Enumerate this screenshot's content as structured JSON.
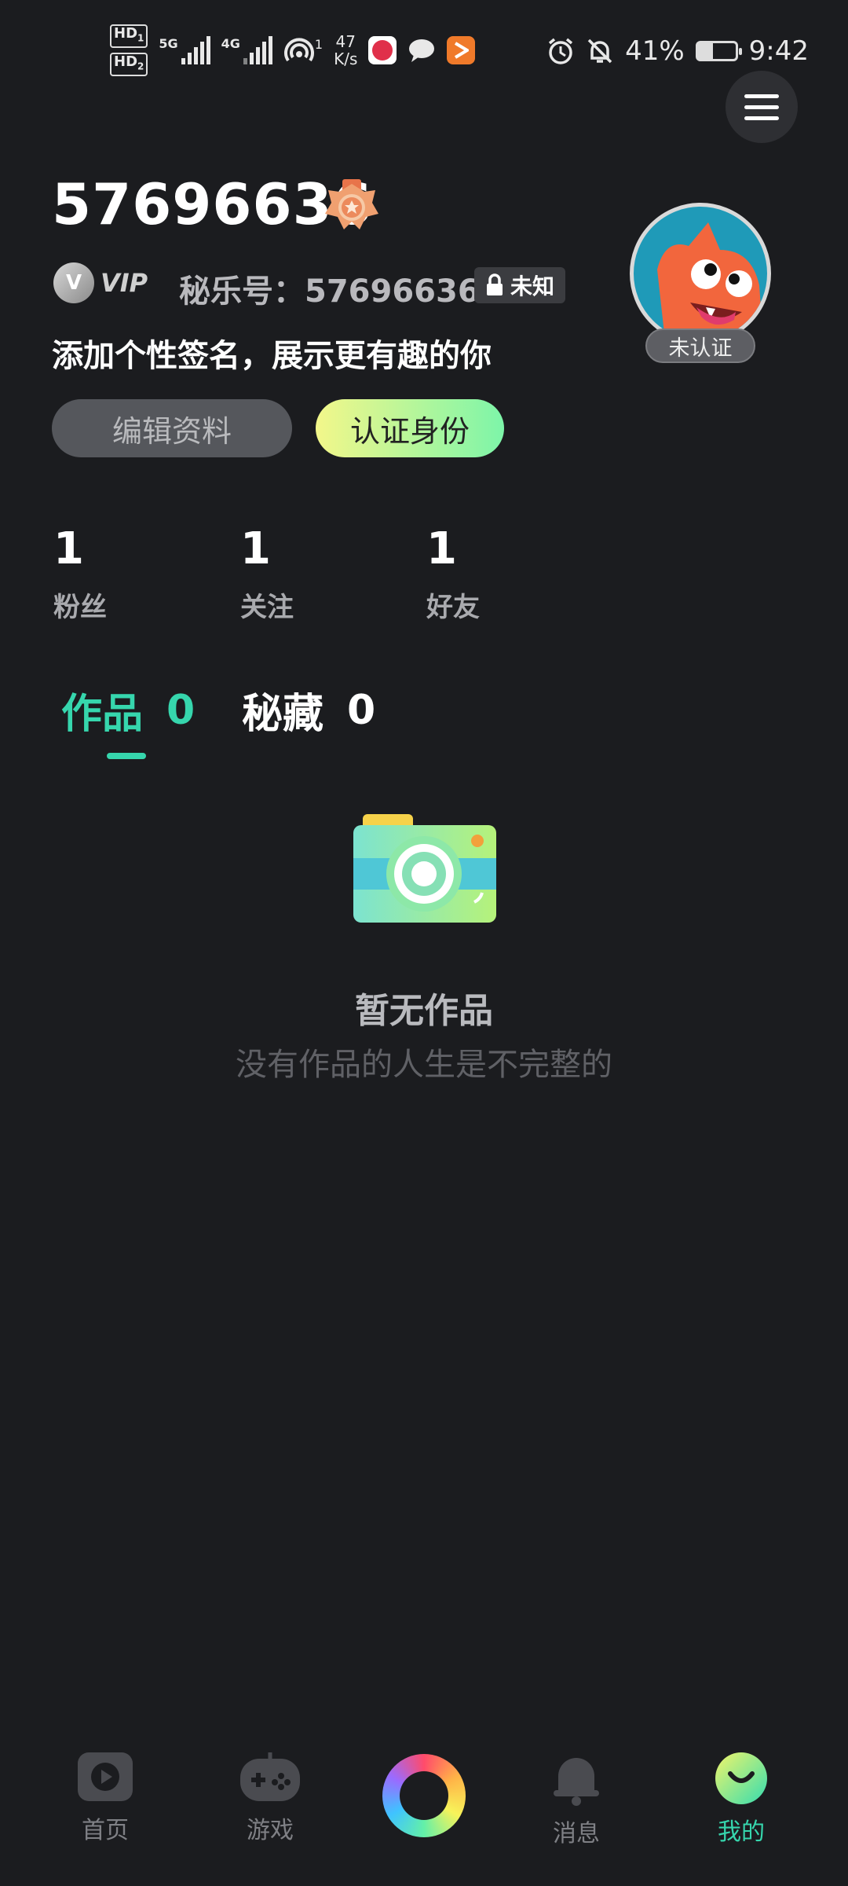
{
  "status_bar": {
    "hd1": "HD",
    "hd1_sub": "1",
    "hd2": "HD",
    "hd2_sub": "2",
    "net_5g": "5G",
    "net_4g": "4G",
    "hotspot_count": "1",
    "speed_value": "47",
    "speed_unit": "K/s",
    "battery_percent": "41%",
    "battery_level": 0.41,
    "time": "9:42"
  },
  "profile": {
    "username": "57696636",
    "vip_label": "VIP",
    "vip_badge": "V",
    "miluo_id": "秘乐号：57696636",
    "lock_label": "未知",
    "signature": "添加个性签名，展示更有趣的你",
    "verify_status": "未认证",
    "edit_button": "编辑资料",
    "verify_button": "认证身份"
  },
  "stats": [
    {
      "num": "1",
      "label": "粉丝"
    },
    {
      "num": "1",
      "label": "关注"
    },
    {
      "num": "1",
      "label": "好友"
    }
  ],
  "tabs": [
    {
      "label": "作品",
      "count": "0"
    },
    {
      "label": "秘藏",
      "count": "0"
    }
  ],
  "empty_state": {
    "title": "暂无作品",
    "subtitle": "没有作品的人生是不完整的"
  },
  "bottom_nav": [
    {
      "label": "首页",
      "icon": "play-icon"
    },
    {
      "label": "游戏",
      "icon": "gamepad-icon"
    },
    {
      "label": "",
      "icon": "create-ring-icon"
    },
    {
      "label": "消息",
      "icon": "bell-icon"
    },
    {
      "label": "我的",
      "icon": "smile-face-icon"
    }
  ],
  "colors": {
    "background": "#1b1c1f",
    "accent": "#36d6ad",
    "verify_gradient_start": "#f3f78a",
    "verify_gradient_end": "#7df5a9"
  }
}
